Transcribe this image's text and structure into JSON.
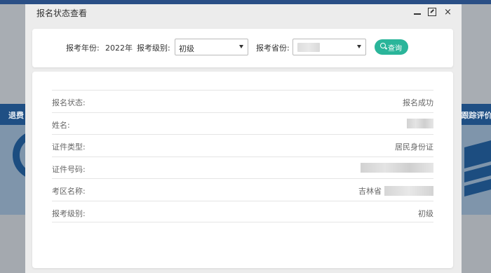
{
  "background": {
    "band_left_text": "退费",
    "band_right_text": "E跟踪评价"
  },
  "modal": {
    "title": "报名状态查看",
    "controls": {
      "minimize": "minimize",
      "maximize": "maximize",
      "close": "×"
    }
  },
  "search": {
    "year_label": "报考年份:",
    "year_value": "2022年",
    "level_label": "报考级别:",
    "level_selected": "初级",
    "province_label": "报考省份:",
    "province_selected": "",
    "query_label": "查询"
  },
  "result": {
    "rows": [
      {
        "key": "报名状态:",
        "value": "报名成功"
      },
      {
        "key": "姓名:",
        "value": ""
      },
      {
        "key": "证件类型:",
        "value": "居民身份证"
      },
      {
        "key": "证件号码:",
        "value": ""
      },
      {
        "key": "考区名称:",
        "value": "吉林省"
      },
      {
        "key": "报考级别:",
        "value": "初级"
      }
    ]
  },
  "colors": {
    "accent": "#2ab59a",
    "header_band": "#1f4f84"
  }
}
